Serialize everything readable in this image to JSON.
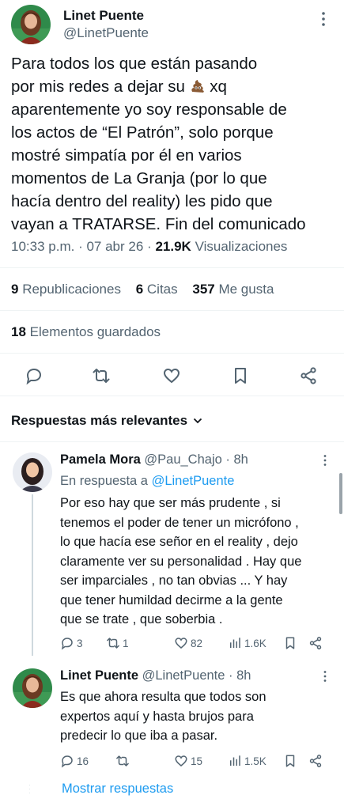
{
  "tweet": {
    "author_name": "Linet Puente",
    "author_handle": "@LinetPuente",
    "text_lines": [
      "Para todos los que están pasando",
      "por mis redes a dejar su",
      " xq",
      "aparentemente yo soy responsable de",
      "los actos de “El Patrón”, solo porque",
      "mostré simpatía por él en varios",
      "momentos de La Granja (por lo que",
      "hacía dentro del reality) les pido que",
      "vayan a TRATARSE. Fin del comunicado"
    ],
    "time": "10:33 p.m.",
    "date": "07 abr 26",
    "sep": "·",
    "views_count": "21.9K",
    "views_label": "Visualizaciones",
    "emoji_icon": "poop-emoji"
  },
  "stats": {
    "reposts_count": "9",
    "reposts_label": "Republicaciones",
    "quotes_count": "6",
    "quotes_label": "Citas",
    "likes_count": "357",
    "likes_label": "Me gusta",
    "bookmarks_count": "18",
    "bookmarks_label": "Elementos guardados"
  },
  "actions": [
    "reply-icon",
    "repost-icon",
    "like-icon",
    "bookmark-icon",
    "share-icon"
  ],
  "replies_header": "Respuestas más relevantes",
  "replies": [
    {
      "name": "Pamela Mora",
      "handle": "@Pau_Chajo",
      "time": "· 8h",
      "replying_to_label": "En respuesta a",
      "replying_to_handle": "@LinetPuente",
      "text_lines": [
        "Por eso hay que ser más prudente , si",
        "tenemos el poder de tener un micrófono ,",
        "lo que hacía ese señor en el reality , dejo",
        "claramente ver su personalidad .  Hay que",
        "ser imparciales , no tan obvias ... Y hay",
        "que tener humildad decirme a la gente",
        "que se trate , que soberbia ."
      ],
      "replies": "3",
      "reposts": "1",
      "likes": "82",
      "views": "1.6K"
    },
    {
      "name": "Linet Puente",
      "handle": "@LinetPuente",
      "time": "· 8h",
      "text_lines": [
        "Es que ahora resulta que todos son",
        "expertos aquí y hasta brujos para",
        "predecir lo que iba a pasar."
      ],
      "replies": "16",
      "reposts": "",
      "likes": "15",
      "views": "1.5K"
    }
  ],
  "show_replies": "Mostrar respuestas",
  "colors": {
    "text": "#0f1419",
    "secondary": "#536471",
    "link": "#1d9bf0",
    "divider": "#eff3f4"
  }
}
